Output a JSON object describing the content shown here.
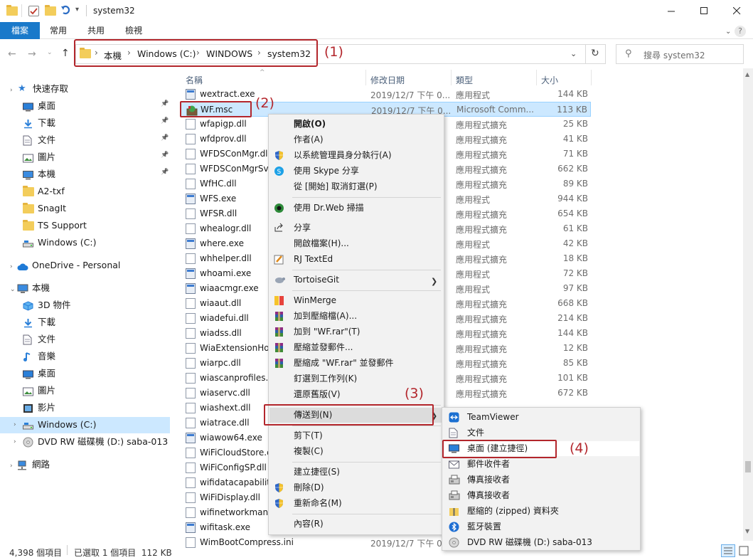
{
  "window": {
    "title": "system32"
  },
  "ribbon": {
    "tabs": [
      "檔案",
      "常用",
      "共用",
      "檢視"
    ]
  },
  "address": {
    "crumbs": [
      "本機",
      "Windows (C:)",
      "WINDOWS",
      "system32"
    ],
    "search_placeholder": "搜尋 system32"
  },
  "annotations": [
    "(1)",
    "(2)",
    "(3)",
    "(4)"
  ],
  "sidebar": {
    "quick_access": "快速存取",
    "quick_items": [
      "桌面",
      "下載",
      "文件",
      "圖片",
      "本機",
      "A2-txf",
      "SnagIt",
      "TS Support",
      "Windows (C:)"
    ],
    "onedrive": "OneDrive - Personal",
    "this_pc": "本機",
    "pc_items": [
      "3D 物件",
      "下載",
      "文件",
      "音樂",
      "桌面",
      "圖片",
      "影片",
      "Windows (C:)",
      "DVD RW 磁碟機 (D:) saba-013"
    ],
    "network": "網路"
  },
  "columns": [
    "名稱",
    "修改日期",
    "類型",
    "大小"
  ],
  "files": [
    {
      "name": "wextract.exe",
      "date": "2019/12/7 下午 0...",
      "type": "應用程式",
      "size": "144 KB",
      "kind": "exe"
    },
    {
      "name": "WF.msc",
      "date": "2019/12/7 下午 0...",
      "type": "Microsoft Comm...",
      "size": "113 KB",
      "kind": "msc"
    },
    {
      "name": "wfapigp.dll",
      "date": "",
      "type": "應用程式擴充",
      "size": "25 KB",
      "kind": "dll"
    },
    {
      "name": "wfdprov.dll",
      "date": "",
      "type": "應用程式擴充",
      "size": "41 KB",
      "kind": "dll"
    },
    {
      "name": "WFDSConMgr.dll",
      "date": "",
      "type": "應用程式擴充",
      "size": "71 KB",
      "kind": "dll"
    },
    {
      "name": "WFDSConMgrSvc",
      "date": "",
      "type": "應用程式擴充",
      "size": "662 KB",
      "kind": "dll"
    },
    {
      "name": "WfHC.dll",
      "date": "",
      "type": "應用程式擴充",
      "size": "89 KB",
      "kind": "dll"
    },
    {
      "name": "WFS.exe",
      "date": "",
      "type": "應用程式",
      "size": "944 KB",
      "kind": "exe"
    },
    {
      "name": "WFSR.dll",
      "date": "",
      "type": "應用程式擴充",
      "size": "654 KB",
      "kind": "dll"
    },
    {
      "name": "whealogr.dll",
      "date": "",
      "type": "應用程式擴充",
      "size": "61 KB",
      "kind": "dll"
    },
    {
      "name": "where.exe",
      "date": "",
      "type": "應用程式",
      "size": "42 KB",
      "kind": "exe"
    },
    {
      "name": "whhelper.dll",
      "date": "",
      "type": "應用程式擴充",
      "size": "18 KB",
      "kind": "dll"
    },
    {
      "name": "whoami.exe",
      "date": "",
      "type": "應用程式",
      "size": "72 KB",
      "kind": "exe"
    },
    {
      "name": "wiaacmgr.exe",
      "date": "",
      "type": "應用程式",
      "size": "97 KB",
      "kind": "exe"
    },
    {
      "name": "wiaaut.dll",
      "date": "",
      "type": "應用程式擴充",
      "size": "668 KB",
      "kind": "dll"
    },
    {
      "name": "wiadefui.dll",
      "date": "",
      "type": "應用程式擴充",
      "size": "214 KB",
      "kind": "dll"
    },
    {
      "name": "wiadss.dll",
      "date": "",
      "type": "應用程式擴充",
      "size": "144 KB",
      "kind": "dll"
    },
    {
      "name": "WiaExtensionHos",
      "date": "",
      "type": "應用程式擴充",
      "size": "12 KB",
      "kind": "dll"
    },
    {
      "name": "wiarpc.dll",
      "date": "",
      "type": "應用程式擴充",
      "size": "85 KB",
      "kind": "dll"
    },
    {
      "name": "wiascanprofiles.d",
      "date": "",
      "type": "應用程式擴充",
      "size": "101 KB",
      "kind": "dll"
    },
    {
      "name": "wiaservc.dll",
      "date": "",
      "type": "應用程式擴充",
      "size": "672 KB",
      "kind": "dll"
    },
    {
      "name": "wiashext.dll",
      "date": "",
      "type": "",
      "size": "",
      "kind": "dll"
    },
    {
      "name": "wiatrace.dll",
      "date": "",
      "type": "",
      "size": "",
      "kind": "dll"
    },
    {
      "name": "wiawow64.exe",
      "date": "",
      "type": "",
      "size": "",
      "kind": "exe"
    },
    {
      "name": "WiFiCloudStore.d",
      "date": "",
      "type": "",
      "size": "",
      "kind": "dll"
    },
    {
      "name": "WiFiConfigSP.dll",
      "date": "",
      "type": "",
      "size": "",
      "kind": "dll"
    },
    {
      "name": "wifidatacapability",
      "date": "",
      "type": "",
      "size": "",
      "kind": "dll"
    },
    {
      "name": "WiFiDisplay.dll",
      "date": "",
      "type": "",
      "size": "",
      "kind": "dll"
    },
    {
      "name": "wifinetworkmana",
      "date": "",
      "type": "",
      "size": "",
      "kind": "dll"
    },
    {
      "name": "wifitask.exe",
      "date": "",
      "type": "",
      "size": "",
      "kind": "exe"
    },
    {
      "name": "WimBootCompress.ini",
      "date": "2019/12/7 下午 0...",
      "type": "",
      "size": "",
      "kind": "dll"
    }
  ],
  "context_menu": {
    "items": [
      {
        "label": "開啟(O)",
        "bold": true,
        "icon": ""
      },
      {
        "label": "作者(A)",
        "icon": ""
      },
      {
        "label": "以系統管理員身分執行(A)",
        "icon": "shield-icon"
      },
      {
        "label": "使用 Skype 分享",
        "icon": "skype-icon"
      },
      {
        "label": "從 [開始] 取消釘選(P)",
        "icon": ""
      },
      {
        "label": "使用 Dr.Web 掃描",
        "icon": "drweb-icon"
      },
      {
        "label": "分享",
        "icon": "share-icon"
      },
      {
        "label": "開啟檔案(H)...",
        "icon": ""
      },
      {
        "label": "RJ TextEd",
        "icon": "rjtexted-icon"
      },
      {
        "label": "TortoiseGit",
        "icon": "tortoisegit-icon"
      },
      {
        "label": "WinMerge",
        "icon": "winmerge-icon"
      },
      {
        "label": "加到壓縮檔(A)...",
        "icon": "winrar-icon"
      },
      {
        "label": "加到 \"WF.rar\"(T)",
        "icon": "winrar-icon"
      },
      {
        "label": "壓縮並發郵件...",
        "icon": "winrar-icon"
      },
      {
        "label": "壓縮成 \"WF.rar\" 並發郵件",
        "icon": "winrar-icon"
      },
      {
        "label": "釘選到工作列(K)",
        "icon": ""
      },
      {
        "label": "還原舊版(V)",
        "icon": ""
      },
      {
        "label": "傳送到(N)",
        "icon": ""
      },
      {
        "label": "剪下(T)",
        "icon": ""
      },
      {
        "label": "複製(C)",
        "icon": ""
      },
      {
        "label": "建立捷徑(S)",
        "icon": ""
      },
      {
        "label": "刪除(D)",
        "icon": "shield-icon"
      },
      {
        "label": "重新命名(M)",
        "icon": "shield-icon"
      },
      {
        "label": "內容(R)",
        "icon": ""
      }
    ]
  },
  "sendto_menu": {
    "items": [
      {
        "label": "TeamViewer",
        "icon": "teamviewer-icon"
      },
      {
        "label": "文件",
        "icon": "document-icon"
      },
      {
        "label": "桌面 (建立捷徑)",
        "icon": "desktop-icon"
      },
      {
        "label": "郵件收件者",
        "icon": "mail-icon"
      },
      {
        "label": "傳真接收者",
        "icon": "fax-icon"
      },
      {
        "label": "傳真接收者",
        "icon": "fax-icon"
      },
      {
        "label": "壓縮的 (zipped) 資料夾",
        "icon": "zip-folder-icon"
      },
      {
        "label": "藍牙裝置",
        "icon": "bluetooth-icon"
      },
      {
        "label": "DVD RW 磁碟機 (D:) saba-013",
        "icon": "dvd-icon"
      }
    ]
  },
  "status": {
    "count": "4,398 個項目",
    "selected": "已選取 1 個項目  112 KB"
  },
  "colors": {
    "accent": "#1979ca",
    "highlight": "#cce8ff",
    "annotation": "#b3262c"
  }
}
